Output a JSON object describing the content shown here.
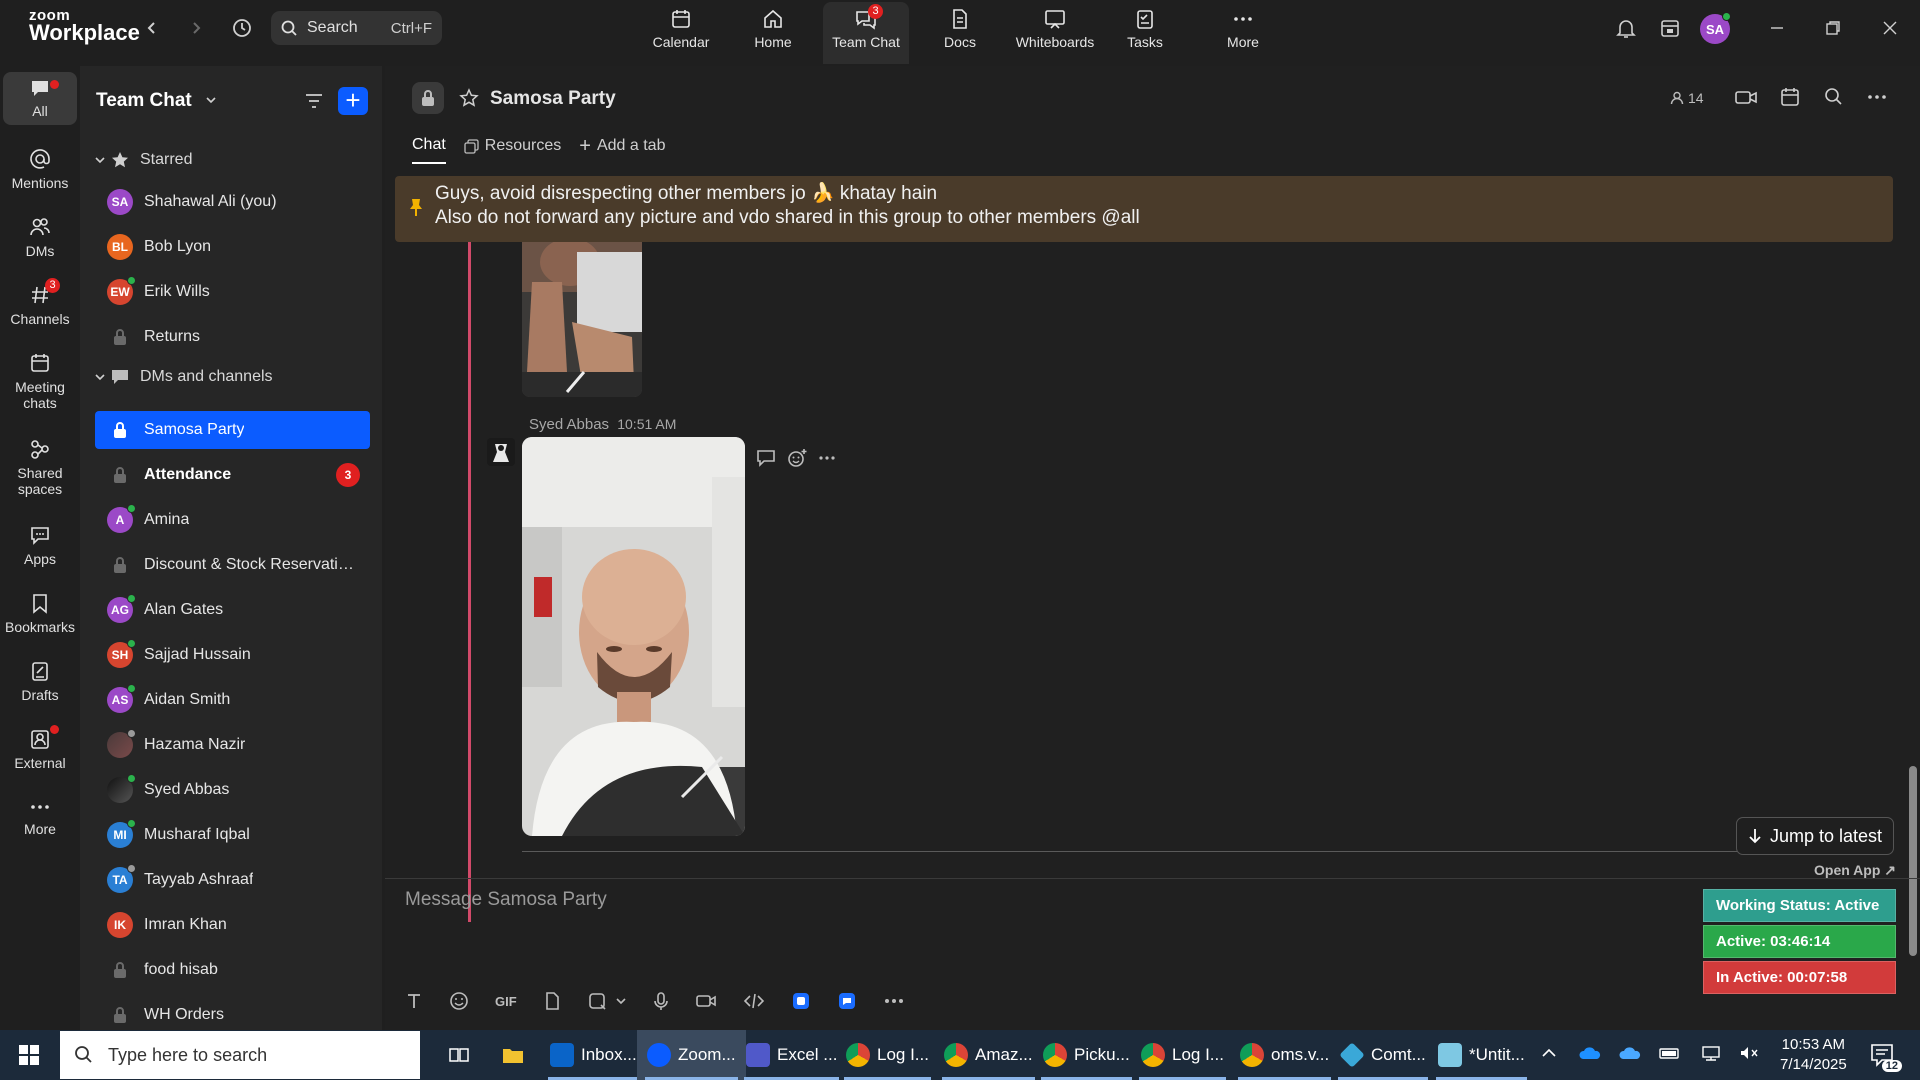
{
  "app": {
    "logo_line1": "zoom",
    "logo_line2": "Workplace"
  },
  "topbar": {
    "search_label": "Search",
    "search_shortcut": "Ctrl+F",
    "nav": [
      {
        "label": "Calendar"
      },
      {
        "label": "Home"
      },
      {
        "label": "Team Chat",
        "badge": "3"
      },
      {
        "label": "Docs"
      },
      {
        "label": "Whiteboards"
      },
      {
        "label": "Tasks"
      },
      {
        "label": "More"
      }
    ],
    "avatar_initials": "SA"
  },
  "rail": {
    "items": [
      {
        "label": "All"
      },
      {
        "label": "Mentions"
      },
      {
        "label": "DMs"
      },
      {
        "label": "Channels",
        "badge": "3"
      },
      {
        "label": "Meeting chats"
      },
      {
        "label": "Shared spaces"
      },
      {
        "label": "Apps"
      },
      {
        "label": "Bookmarks"
      },
      {
        "label": "Drafts"
      },
      {
        "label": "External"
      },
      {
        "label": "More"
      }
    ]
  },
  "sidebar": {
    "title": "Team Chat",
    "starred_label": "Starred",
    "starred": [
      {
        "name": "Shahawal Ali (you)",
        "initials": "SA",
        "color": "#9b49c7"
      },
      {
        "name": "Bob Lyon",
        "initials": "BL",
        "color": "#e8661f"
      },
      {
        "name": "Erik Wills",
        "initials": "EW",
        "color": "#d6452f"
      },
      {
        "name": "Returns"
      }
    ],
    "dms_label": "DMs and channels",
    "items": [
      {
        "name": "Samosa Party"
      },
      {
        "name": "Attendance",
        "count": "3"
      },
      {
        "name": "Amina",
        "initials": "A",
        "color": "#9b49c7"
      },
      {
        "name": "Discount & Stock Reservatio..."
      },
      {
        "name": "Alan Gates",
        "initials": "AG",
        "color": "#9b49c7"
      },
      {
        "name": "Sajjad Hussain",
        "initials": "SH",
        "color": "#d6452f"
      },
      {
        "name": "Aidan Smith",
        "initials": "AS",
        "color": "#9b49c7"
      },
      {
        "name": "Hazama Nazir"
      },
      {
        "name": "Syed Abbas"
      },
      {
        "name": "Musharaf Iqbal",
        "initials": "MI",
        "color": "#2a7fd4"
      },
      {
        "name": "Tayyab Ashraaf",
        "initials": "TA",
        "color": "#2a7fd4"
      },
      {
        "name": "Imran Khan",
        "initials": "IK",
        "color": "#d6452f"
      },
      {
        "name": "food hisab"
      },
      {
        "name": "WH Orders"
      }
    ]
  },
  "channel": {
    "name": "Samosa Party",
    "member_count": "14",
    "tabs": [
      {
        "label": "Chat"
      },
      {
        "label": "Resources"
      },
      {
        "label": "Add a tab"
      }
    ],
    "pinned_line1": "Guys, avoid disrespecting other members jo 🍌 khatay hain",
    "pinned_line2": "Also do not forward any picture and vdo shared in this group to other members @all",
    "message_sender": "Syed Abbas",
    "message_time": "10:51 AM",
    "jump_label": "Jump to latest",
    "compose_placeholder": "Message Samosa Party"
  },
  "working_status": {
    "open_app": "Open App ↗",
    "status": "Working Status: Active",
    "active": "Active: 03:46:14",
    "inactive": "In Active: 00:07:58",
    "colors": {
      "status": "#2e9e8e",
      "active": "#2aa84a",
      "inactive": "#d23b3b"
    }
  },
  "taskbar": {
    "search_placeholder": "Type here to search",
    "apps": [
      {
        "label": "Inbox..."
      },
      {
        "label": "Zoom..."
      },
      {
        "label": "Excel ..."
      },
      {
        "label": "Log I..."
      },
      {
        "label": "Amaz..."
      },
      {
        "label": "Picku..."
      },
      {
        "label": "Log I..."
      },
      {
        "label": "oms.v..."
      },
      {
        "label": "Comt..."
      },
      {
        "label": "*Untit..."
      }
    ],
    "time": "10:53 AM",
    "date": "7/14/2025",
    "notifications": "12"
  }
}
